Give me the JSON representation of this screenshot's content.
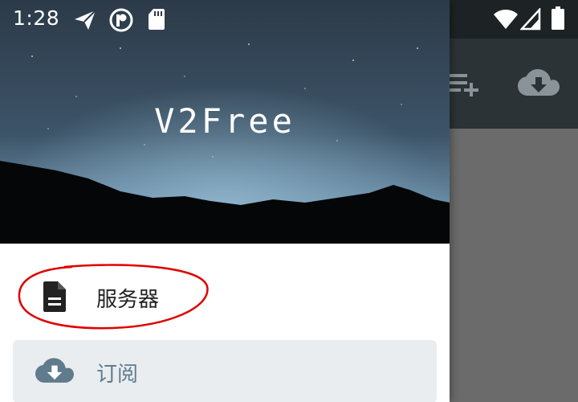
{
  "status_bar": {
    "time": "1:28"
  },
  "drawer": {
    "header_title": "V2Free",
    "items": [
      {
        "label": "服务器",
        "icon": "document-icon"
      },
      {
        "label": "订阅",
        "icon": "cloud-download-icon"
      }
    ]
  },
  "colors": {
    "accent": "#5f7b8c",
    "selected_bg": "#e9edf0",
    "annotation": "#e00000"
  }
}
